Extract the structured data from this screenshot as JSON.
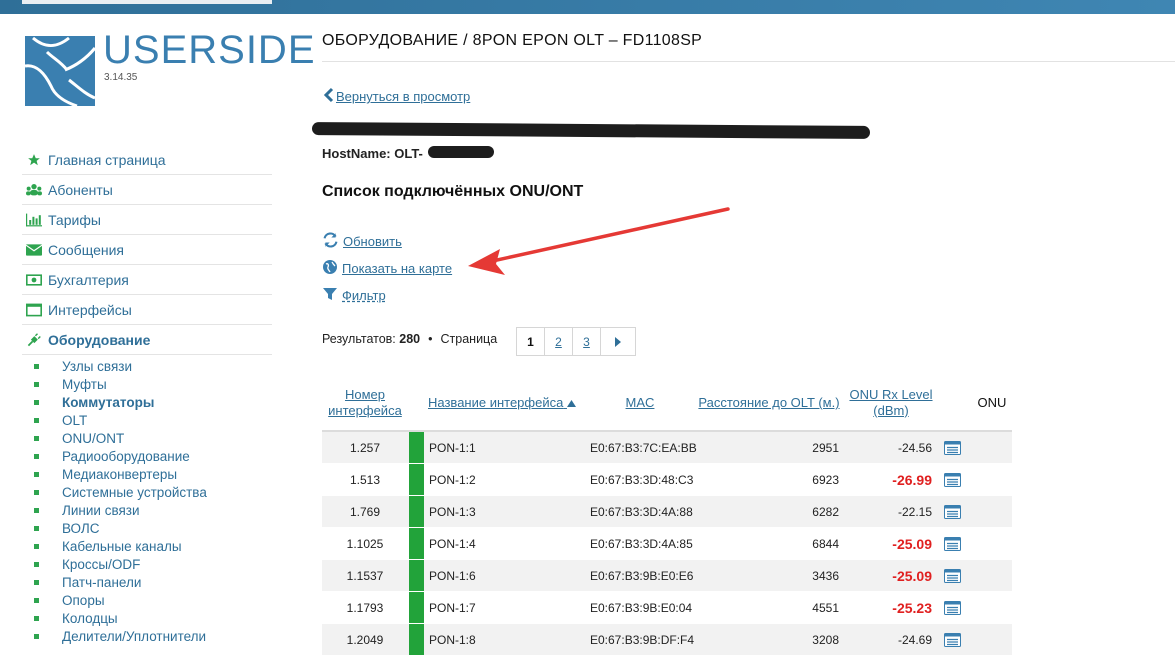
{
  "logo": {
    "name": "USERSIDE",
    "version": "3.14.35"
  },
  "nav": {
    "items": [
      {
        "label": "Главная страница",
        "icon": "star-icon"
      },
      {
        "label": "Абоненты",
        "icon": "users-icon"
      },
      {
        "label": "Тарифы",
        "icon": "bar-chart-icon"
      },
      {
        "label": "Сообщения",
        "icon": "envelope-icon"
      },
      {
        "label": "Бухгалтерия",
        "icon": "money-icon"
      },
      {
        "label": "Интерфейсы",
        "icon": "window-icon"
      },
      {
        "label": "Оборудование",
        "icon": "plug-icon"
      }
    ],
    "sub_items": [
      "Узлы связи",
      "Муфты",
      "Коммутаторы",
      "OLT",
      "ONU/ONT",
      "Радиооборудование",
      "Медиаконвертеры",
      "Системные устройства",
      "Линии связи",
      "ВОЛС",
      "Кабельные каналы",
      "Кроссы/ODF",
      "Патч-панели",
      "Опоры",
      "Колодцы",
      "Делители/Уплотнители"
    ]
  },
  "page": {
    "title": "ОБОРУДОВАНИЕ / 8PON EPON OLT – FD1108SP",
    "back_link": "Вернуться в просмотр",
    "hostname": "HostName: OLT-",
    "section_title": "Список подключённых ONU/ONT",
    "actions": {
      "refresh": "Обновить",
      "map": "Показать на карте",
      "filter": "Фильтр"
    },
    "results_label": "Результатов:",
    "results_count": "280",
    "page_label": "Страница",
    "pages": [
      "1",
      "2",
      "3"
    ]
  },
  "table": {
    "headers": {
      "num": "Номер интерфейса",
      "name": "Название интерфейса",
      "mac": "MAC",
      "distance": "Расстояние до OLT (м.)",
      "rx": "ONU Rx Level (dBm)",
      "onu": "ONU"
    },
    "rows": [
      {
        "num": "1.257",
        "name": "PON-1:1",
        "mac": "E0:67:B3:7C:EA:BB",
        "distance": "2951",
        "rx": "-24.56",
        "bad": false
      },
      {
        "num": "1.513",
        "name": "PON-1:2",
        "mac": "E0:67:B3:3D:48:C3",
        "distance": "6923",
        "rx": "-26.99",
        "bad": true
      },
      {
        "num": "1.769",
        "name": "PON-1:3",
        "mac": "E0:67:B3:3D:4A:88",
        "distance": "6282",
        "rx": "-22.15",
        "bad": false
      },
      {
        "num": "1.1025",
        "name": "PON-1:4",
        "mac": "E0:67:B3:3D:4A:85",
        "distance": "6844",
        "rx": "-25.09",
        "bad": true
      },
      {
        "num": "1.1537",
        "name": "PON-1:6",
        "mac": "E0:67:B3:9B:E0:E6",
        "distance": "3436",
        "rx": "-25.09",
        "bad": true
      },
      {
        "num": "1.1793",
        "name": "PON-1:7",
        "mac": "E0:67:B3:9B:E0:04",
        "distance": "4551",
        "rx": "-25.23",
        "bad": true
      },
      {
        "num": "1.2049",
        "name": "PON-1:8",
        "mac": "E0:67:B3:9B:DF:F4",
        "distance": "3208",
        "rx": "-24.69",
        "bad": false
      }
    ]
  },
  "colors": {
    "accent": "#2f6f98",
    "status_ok": "#22a33a",
    "rx_bad": "#e02020",
    "annotation_arrow": "#e53935"
  }
}
